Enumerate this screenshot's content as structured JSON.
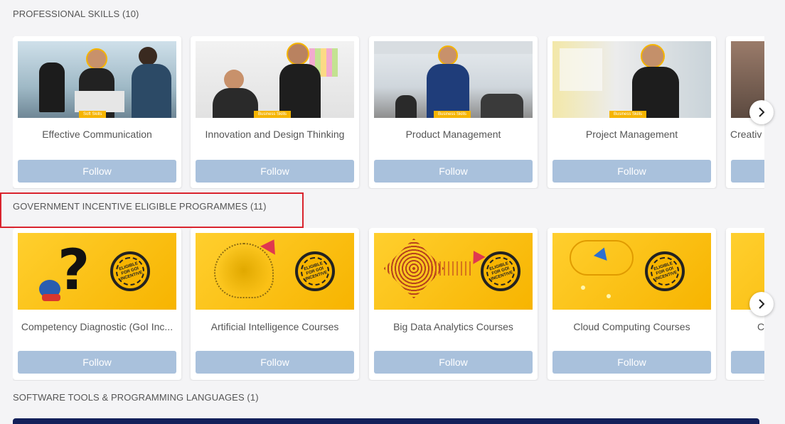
{
  "sections": [
    {
      "title": "PROFESSIONAL SKILLS (10)",
      "cards": [
        {
          "name": "Effective Communication",
          "tag": "Soft Skills",
          "follow": "Follow"
        },
        {
          "name": "Innovation and Design Thinking",
          "tag": "Business Skills",
          "follow": "Follow"
        },
        {
          "name": "Product Management",
          "tag": "Business Skills",
          "follow": "Follow"
        },
        {
          "name": "Project Management",
          "tag": "Business Skills",
          "follow": "Follow"
        },
        {
          "name": "Creativ",
          "tag": "",
          "follow": ""
        }
      ]
    },
    {
      "title": "GOVERNMENT INCENTIVE ELIGIBLE PROGRAMMES (11)",
      "cards": [
        {
          "name": "Competency Diagnostic (GoI Inc...",
          "badge": "ELIGIBLE FOR GOI INCENTIVE",
          "follow": "Follow"
        },
        {
          "name": "Artificial Intelligence Courses",
          "badge": "ELIGIBLE FOR GOI INCENTIVE",
          "follow": "Follow"
        },
        {
          "name": "Big Data Analytics Courses",
          "badge": "ELIGIBLE FOR GOI INCENTIVE",
          "follow": "Follow"
        },
        {
          "name": "Cloud Computing Courses",
          "badge": "ELIGIBLE FOR GOI INCENTIVE",
          "follow": "Follow"
        },
        {
          "name": "C",
          "follow": ""
        }
      ]
    },
    {
      "title": "SOFTWARE TOOLS & PROGRAMMING LANGUAGES (1)"
    }
  ],
  "icons": {
    "next": "chevron-right-icon"
  }
}
